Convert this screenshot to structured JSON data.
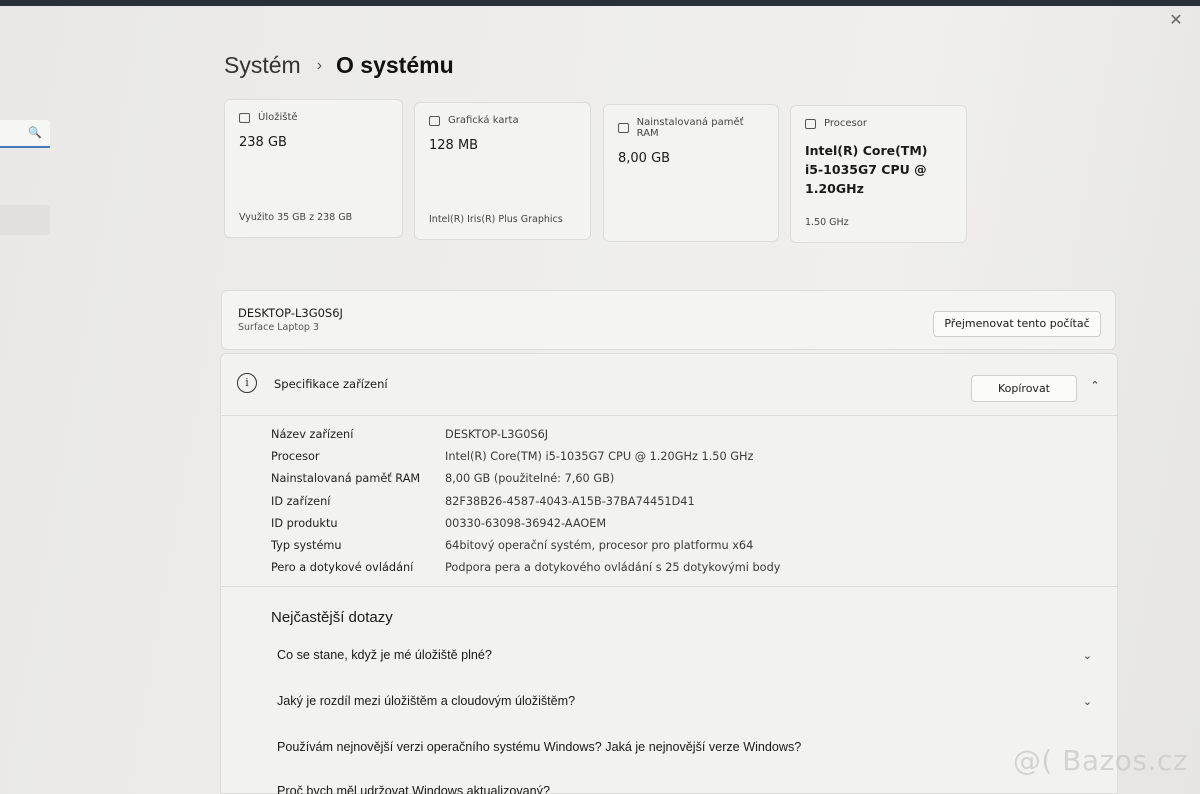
{
  "breadcrumb": {
    "parent": "Systém",
    "separator": "›",
    "current": "O systému"
  },
  "sidebar": {
    "search_icon": "🔍"
  },
  "tiles": {
    "storage": {
      "label": "Úložiště",
      "value": "238 GB",
      "footer": "Využito 35 GB z 238 GB",
      "icon": "storage-icon"
    },
    "gpu": {
      "label": "Grafická karta",
      "value": "128 MB",
      "footer": "Intel(R) Iris(R) Plus Graphics",
      "icon": "gpu-icon"
    },
    "ram": {
      "label": "Nainstalovaná paměť RAM",
      "value": "8,00 GB",
      "footer": "",
      "icon": "ram-icon"
    },
    "cpu": {
      "label": "Procesor",
      "value_line1": "Intel(R) Core(TM)",
      "value_line2": "i5-1035G7 CPU @",
      "value_line3": "1.20GHz",
      "footer": "1.50 GHz",
      "icon": "cpu-icon"
    }
  },
  "device": {
    "name": "DESKTOP-L3G0S6J",
    "model": "Surface Laptop 3",
    "rename_label": "Přejmenovat tento počítač"
  },
  "specs": {
    "title": "Specifikace zařízení",
    "copy_label": "Kopírovat",
    "rows": [
      {
        "label": "Název zařízení",
        "value": "DESKTOP-L3G0S6J"
      },
      {
        "label": "Procesor",
        "value": "Intel(R) Core(TM) i5-1035G7 CPU @ 1.20GHz   1.50 GHz"
      },
      {
        "label": "Nainstalovaná paměť RAM",
        "value": "8,00 GB (použitelné: 7,60 GB)"
      },
      {
        "label": "ID zařízení",
        "value": "82F38B26-4587-4043-A15B-37BA74451D41"
      },
      {
        "label": "ID produktu",
        "value": "00330-63098-36942-AAOEM"
      },
      {
        "label": "Typ systému",
        "value": "64bitový operační systém, procesor pro platformu x64"
      },
      {
        "label": "Pero a dotykové ovládání",
        "value": "Podpora pera a dotykového ovládání s 25 dotykovými body"
      }
    ]
  },
  "faq": {
    "title": "Nejčastější dotazy",
    "items": [
      "Co se stane, když je mé úložiště plné?",
      "Jaký je rozdíl mezi úložištěm a cloudovým úložištěm?",
      "Používám nejnovější verzi operačního systému Windows? Jaká je nejnovější verze Windows?",
      "Proč bych měl udržovat Windows aktualizovaný?"
    ]
  },
  "watermark": "@( Bazos.cz"
}
